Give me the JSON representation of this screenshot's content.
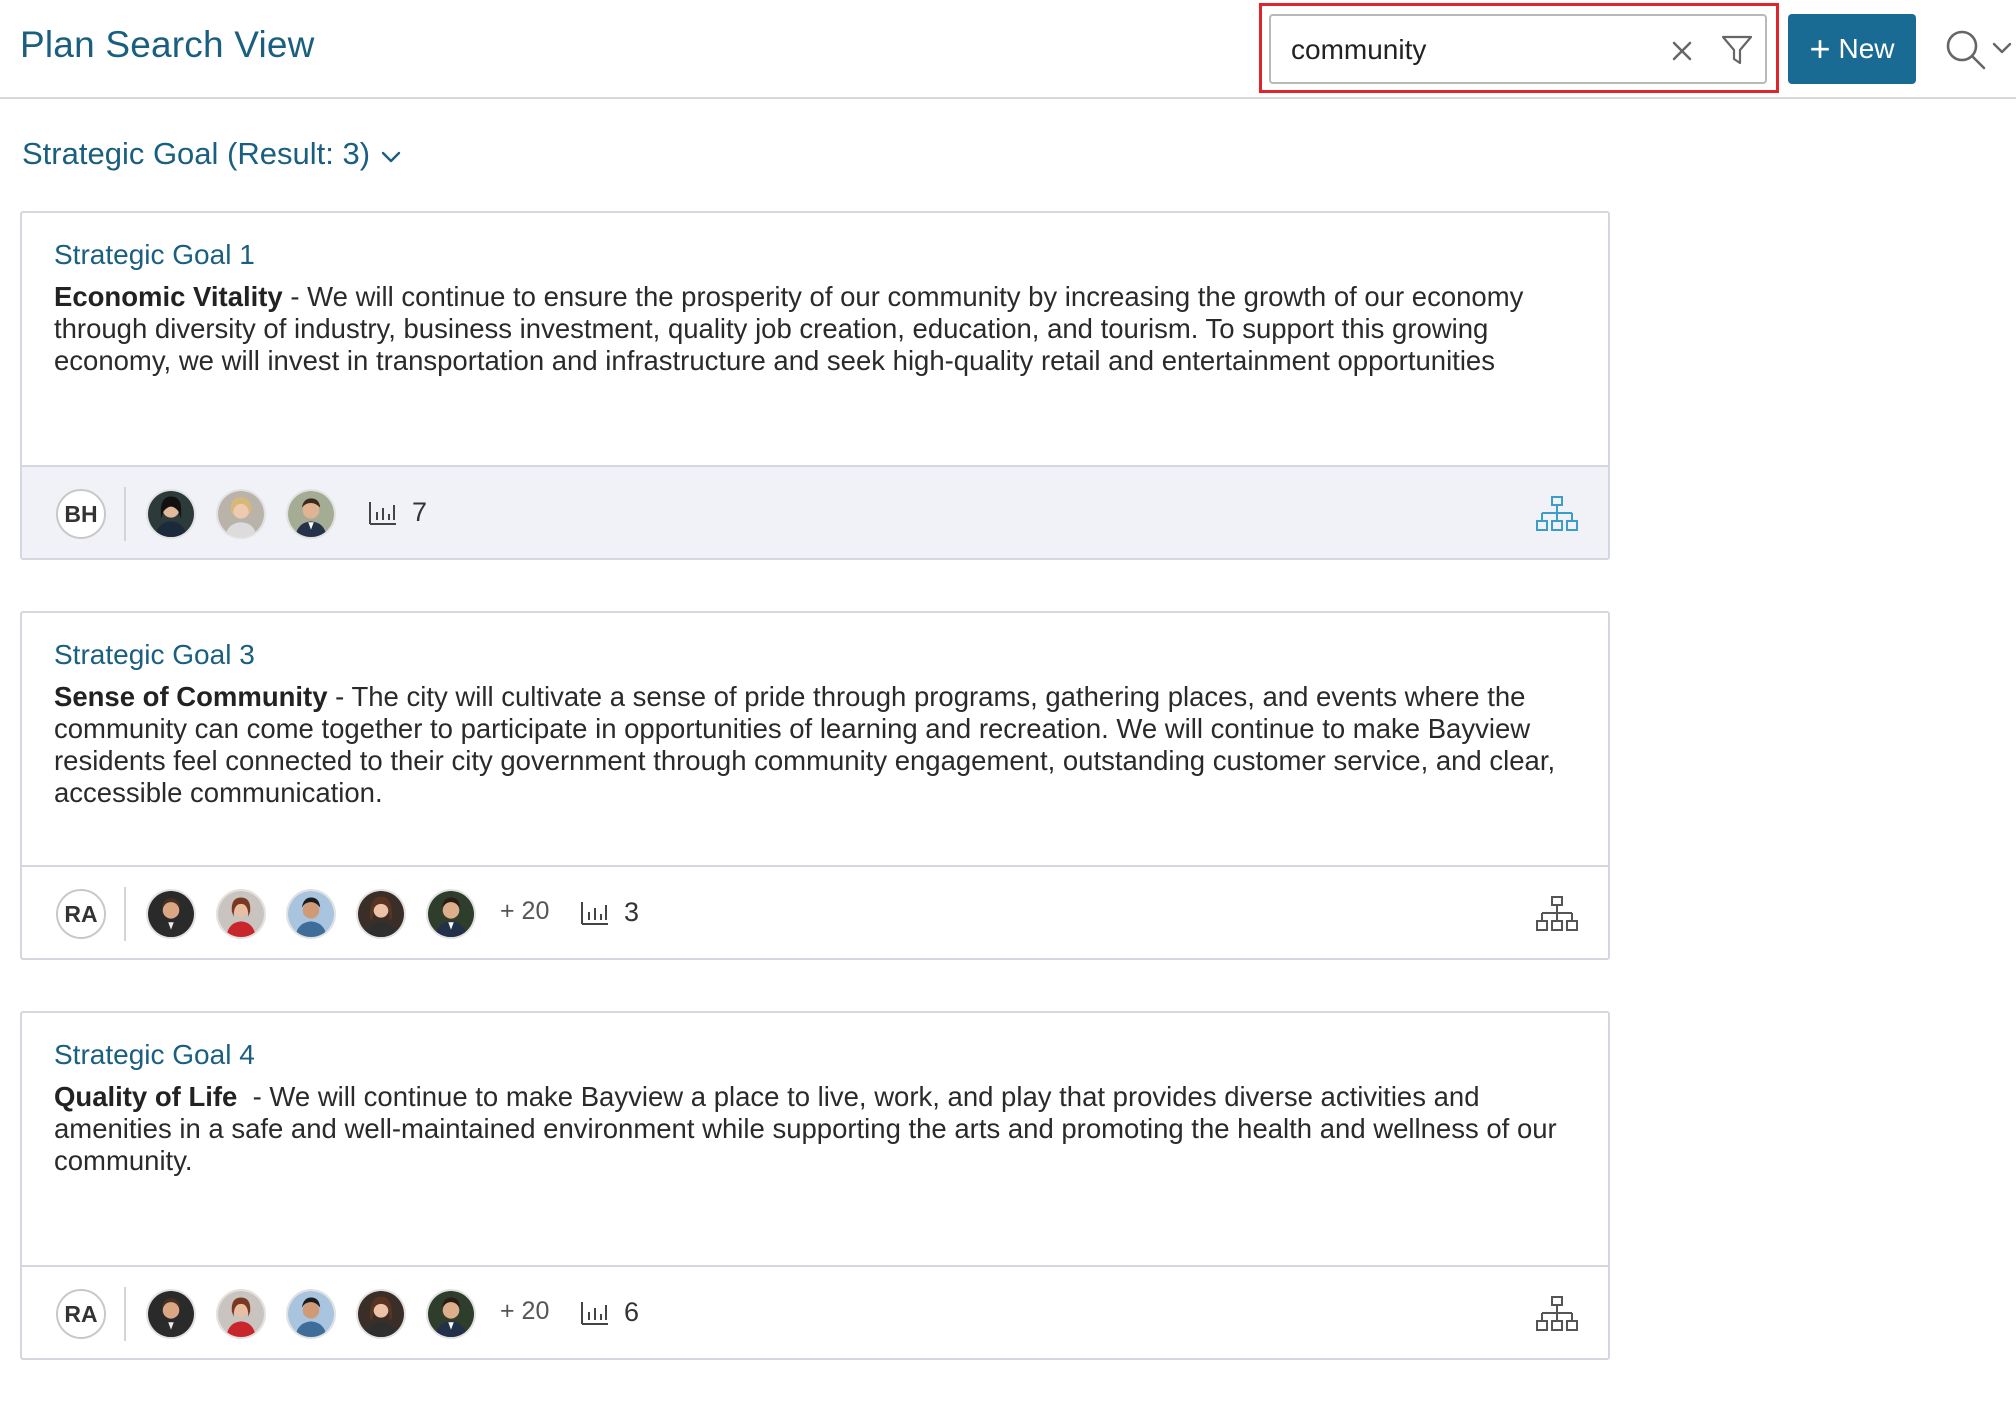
{
  "header": {
    "title": "Plan Search View",
    "search_value": "community",
    "new_label": "New"
  },
  "section": {
    "heading": "Strategic Goal (Result: 3)"
  },
  "cards": [
    {
      "title": "Strategic Goal 1",
      "name": "Economic Vitality",
      "description": " - We will continue to ensure the prosperity of our community by increasing the growth of our economy through diversity of industry, business investment, quality job creation, education, and tourism. To support this growing economy, we will invest in transportation and infrastructure and seek high-quality retail and entertainment opportunities",
      "owner": "BH",
      "more": "",
      "metric_count": "7",
      "org_icon_color": "#3a9ec9"
    },
    {
      "title": "Strategic Goal 3",
      "name": "Sense of Community",
      "description": " - The city will cultivate a sense of pride through programs, gathering places, and events where the community can come together to participate in opportunities of learning and recreation. We will continue to make Bayview residents feel connected to their city government through community engagement, outstanding customer service, and clear, accessible communication.",
      "owner": "RA",
      "more": "+ 20",
      "metric_count": "3",
      "org_icon_color": "#555555"
    },
    {
      "title": "Strategic Goal 4",
      "name": "Quality of Life",
      "description": "  - We will continue to make Bayview a place to live, work, and play that provides diverse activities and amenities in a safe and well-maintained environment while supporting the arts and promoting the health and wellness of our community.",
      "owner": "RA",
      "more": "+ 20",
      "metric_count": "6",
      "org_icon_color": "#555555"
    }
  ],
  "colors": {
    "accent": "#1a5f80",
    "button": "#1a6b93",
    "highlight": "#e0242b"
  }
}
